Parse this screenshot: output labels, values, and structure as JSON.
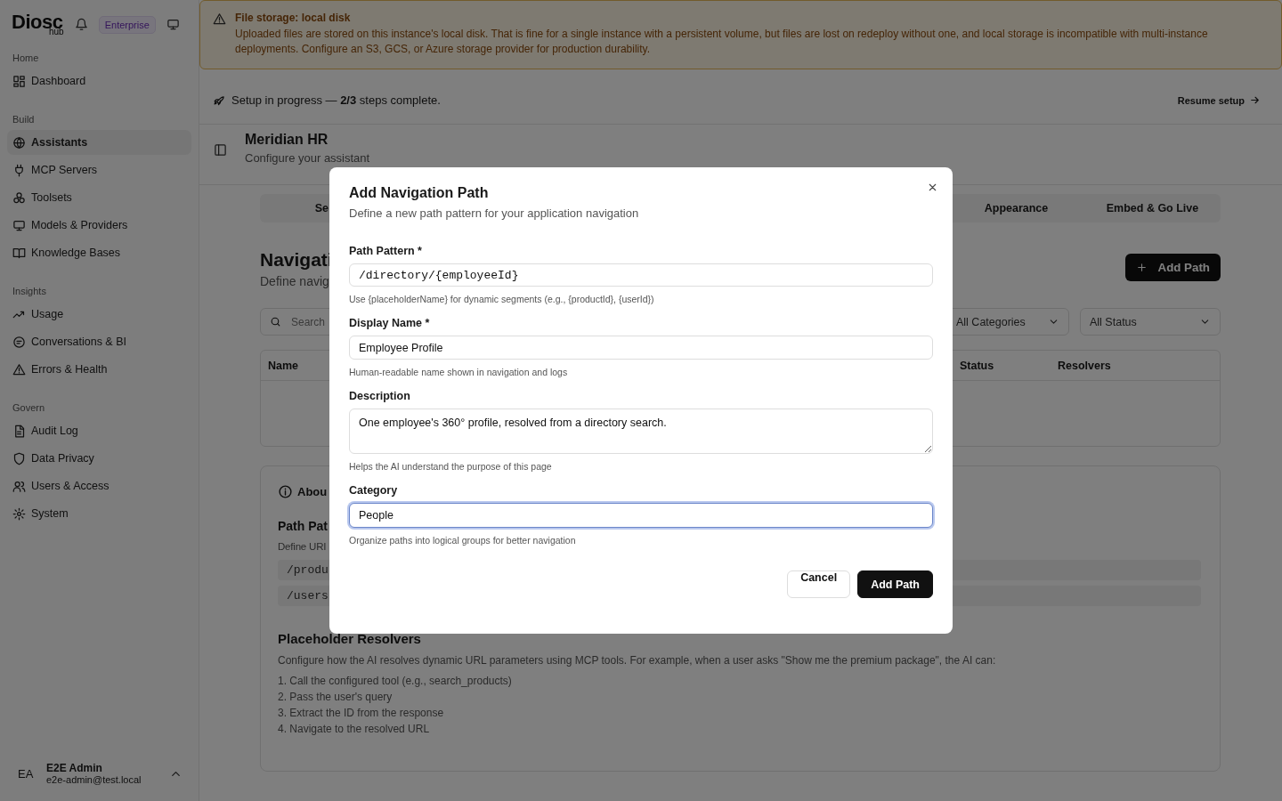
{
  "sidebar": {
    "logo": "Diosc",
    "logo_sub": "hub",
    "badge": "Enterprise",
    "sections": [
      {
        "heading": "Home",
        "items": [
          {
            "label": "Dashboard",
            "selected": false
          }
        ]
      },
      {
        "heading": "Build",
        "items": [
          {
            "label": "Assistants",
            "selected": true
          },
          {
            "label": "MCP Servers",
            "selected": false
          },
          {
            "label": "Toolsets",
            "selected": false
          },
          {
            "label": "Models & Providers",
            "selected": false
          },
          {
            "label": "Knowledge Bases",
            "selected": false
          }
        ]
      },
      {
        "heading": "Insights",
        "items": [
          {
            "label": "Usage",
            "selected": false
          },
          {
            "label": "Conversations & BI",
            "selected": false
          },
          {
            "label": "Errors & Health",
            "selected": false
          }
        ]
      },
      {
        "heading": "Govern",
        "items": [
          {
            "label": "Audit Log",
            "selected": false
          },
          {
            "label": "Data Privacy",
            "selected": false
          },
          {
            "label": "Users & Access",
            "selected": false
          },
          {
            "label": "System",
            "selected": false
          }
        ]
      }
    ],
    "user": {
      "initials": "EA",
      "name": "E2E Admin",
      "email": "e2e-admin@test.local"
    }
  },
  "banner": {
    "title": "File storage: local disk",
    "message": "Uploaded files are stored on this instance's local disk. That is fine for a single instance with a persistent volume, but files are lost on redeploy without one, and local storage is incompatible with multi-instance deployments. Configure an S3, GCS, or Azure storage provider for production durability."
  },
  "setup": {
    "message": "Setup in progress — **2/3** steps complete.",
    "action": "Resume setup"
  },
  "header": {
    "title": "Meridian HR",
    "subtitle": "Configure your assistant"
  },
  "tabs": [
    {
      "label": "Se"
    },
    {
      "label": "Appearance"
    },
    {
      "label": "Embed & Go Live"
    }
  ],
  "page": {
    "title": "Navigati",
    "subtitle": "Define navig",
    "add_button": "Add Path"
  },
  "filters": {
    "search_placeholder": "Search",
    "selects": [
      "All Categories",
      "All Status"
    ]
  },
  "table": {
    "columns": [
      "Name",
      "Status",
      "Resolvers"
    ]
  },
  "about": {
    "title": "Abou",
    "section_title": "Path Pat",
    "section_text": "Define URI",
    "examples": [
      "/produ",
      "/users"
    ],
    "resolvers_title": "Placeholder Resolvers",
    "resolvers_text": "Configure how the AI resolves dynamic URL parameters using MCP tools. For example, when a user asks \"Show me the premium package\", the AI can:",
    "steps": [
      "1. Call the configured tool (e.g., search_products)",
      "2. Pass the user's query",
      "3. Extract the ID from the response",
      "4. Navigate to the resolved URL"
    ]
  },
  "modal": {
    "title": "Add Navigation Path",
    "subtitle": "Define a new path pattern for your application navigation",
    "fields": [
      {
        "kind": "mono",
        "label": "Path Pattern *",
        "value": "/directory/{employeeId}",
        "hint": "Use {placeholderName} for dynamic segments (e.g., {productId}, {userId})",
        "focused": false
      },
      {
        "kind": "text",
        "label": "Display Name *",
        "value": "Employee Profile",
        "hint": "Human-readable name shown in navigation and logs",
        "focused": false
      },
      {
        "kind": "textarea",
        "label": "Description",
        "value": "One employee's 360° profile, resolved from a directory search.",
        "hint": "Helps the AI understand the purpose of this page",
        "focused": false
      },
      {
        "kind": "text",
        "label": "Category",
        "value": "People",
        "hint": "Organize paths into logical groups for better navigation",
        "focused": true
      }
    ],
    "buttons": [
      {
        "kind": "secondary",
        "label": "Cancel"
      },
      {
        "kind": "primary",
        "label": "Add Path"
      }
    ]
  }
}
